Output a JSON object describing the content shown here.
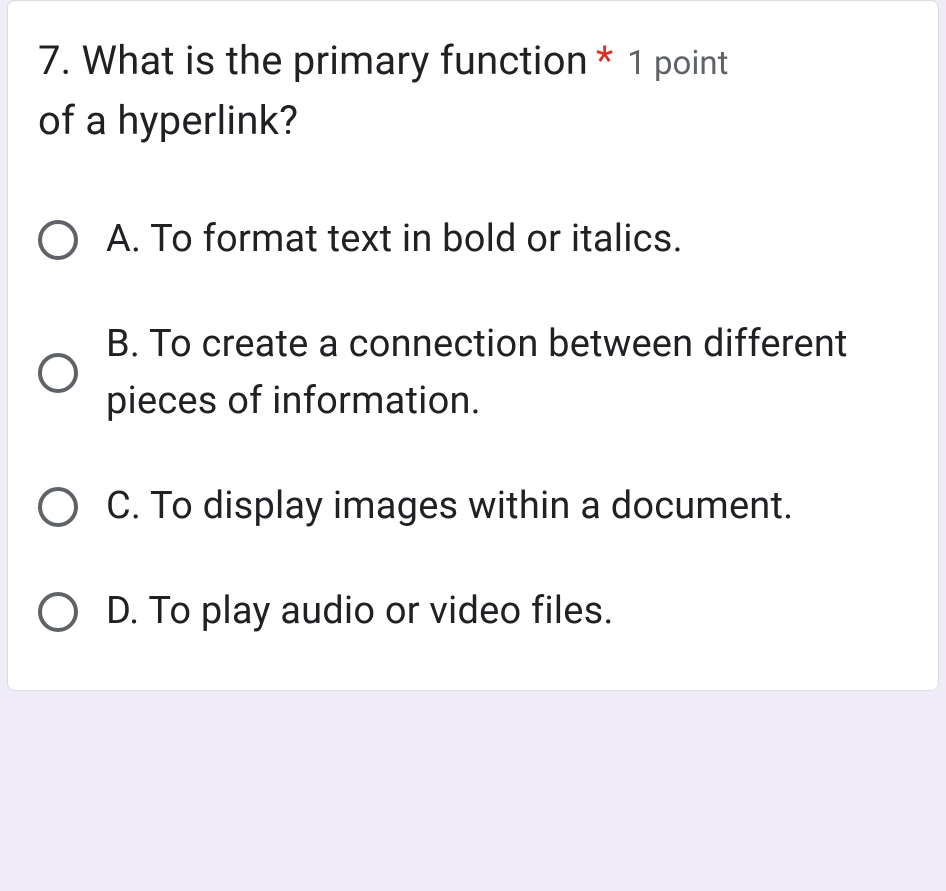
{
  "question": {
    "number_text": "7. What is the primary function",
    "text_line2": "of a hyperlink?",
    "required_mark": "*",
    "points": "1 point"
  },
  "options": [
    {
      "label": "A. To format text in bold or italics."
    },
    {
      "label": "B. To create a connection between different pieces of information."
    },
    {
      "label": "C. To display images within a document."
    },
    {
      "label": "D. To play audio or video files."
    }
  ]
}
